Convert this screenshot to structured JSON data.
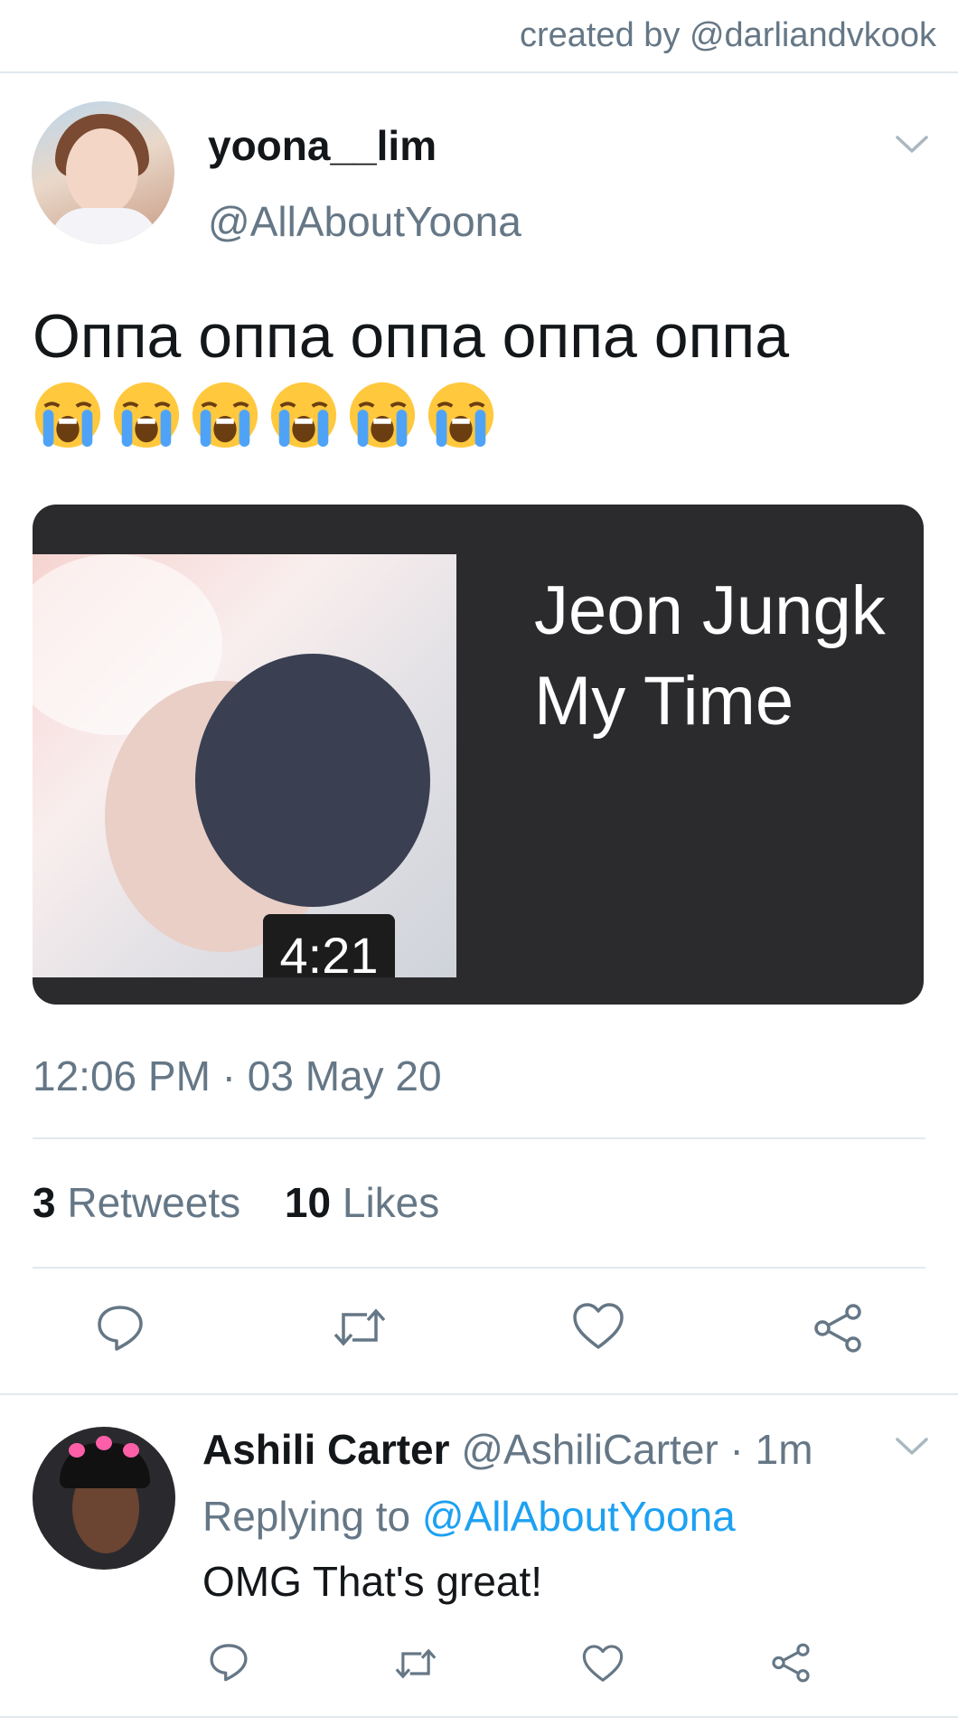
{
  "credit": "created by @darliandvkook",
  "tweet": {
    "name": "yoona__lim",
    "handle": "@AllAboutYoona",
    "text": "Оппа оппа оппа оппа оппа",
    "emoji_count": 6,
    "card": {
      "title_line1": "Jeon Jungk",
      "title_line2": "My Time",
      "duration": "4:21"
    },
    "timestamp": "12:06 PM · 03 May 20",
    "retweets_count": "3",
    "retweets_label": "Retweets",
    "likes_count": "10",
    "likes_label": "Likes"
  },
  "reply": {
    "name": "Ashili Carter",
    "handle_time": "@AshiliCarter · 1m",
    "replying_prefix": "Replying to",
    "replying_handle": "@AllAboutYoona",
    "text": "OMG That's great!"
  },
  "colors": {
    "muted": "#657786",
    "link": "#1da1f2",
    "divider": "#e1e8ed",
    "card_bg": "#2b2b2d"
  }
}
